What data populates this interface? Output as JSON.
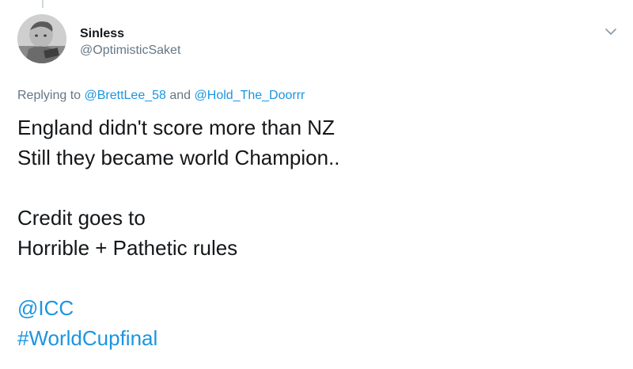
{
  "tweet": {
    "display_name": "Sinless",
    "username": "@OptimisticSaket",
    "replying": {
      "prefix": "Replying to ",
      "mention_1": "@BrettLee_58",
      "conjunction": " and ",
      "mention_2": "@Hold_The_Doorrr"
    },
    "text": {
      "line_1": "England didn't score more than NZ",
      "line_2": "Still they became world Champion..",
      "line_3": "Credit goes to",
      "line_4": "Horrible + Pathetic rules",
      "mention": "@ICC",
      "hashtag": "#WorldCupfinal"
    },
    "icons": {
      "menu": "chevron-down-icon",
      "avatar": "avatar"
    }
  },
  "colors": {
    "link": "#1b95e0",
    "text": "#14171a",
    "secondary": "#657786",
    "thread_line": "#cfd9de"
  }
}
